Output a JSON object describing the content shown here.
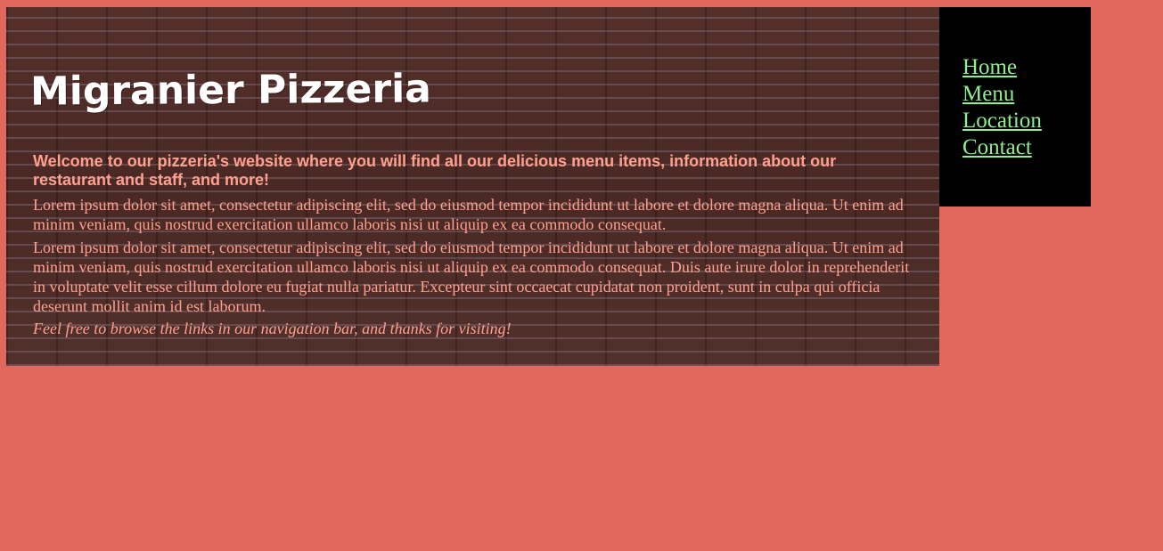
{
  "site": {
    "title": "Migranier Pizzeria",
    "welcome": "Welcome to our pizzeria's website where you will find all our delicious menu items, information about our restaurant and staff, and more!",
    "paragraphs": [
      "Lorem ipsum dolor sit amet, consectetur adipiscing elit, sed do eiusmod tempor incididunt ut labore et dolore magna aliqua. Ut enim ad minim veniam, quis nostrud exercitation ullamco laboris nisi ut aliquip ex ea commodo consequat.",
      "Lorem ipsum dolor sit amet, consectetur adipiscing elit, sed do eiusmod tempor incididunt ut labore et dolore magna aliqua. Ut enim ad minim veniam, quis nostrud exercitation ullamco laboris nisi ut aliquip ex ea commodo consequat. Duis aute irure dolor in reprehenderit in voluptate velit esse cillum dolore eu fugiat nulla pariatur. Excepteur sint occaecat cupidatat non proident, sunt in culpa qui officia deserunt mollit anim id est laborum."
    ],
    "closing": "Feel free to browse the links in our navigation bar, and thanks for visiting!"
  },
  "nav": {
    "items": [
      {
        "label": "Home"
      },
      {
        "label": "Menu"
      },
      {
        "label": "Location"
      },
      {
        "label": "Contact"
      }
    ]
  },
  "colors": {
    "page_background": "#e2685d",
    "text_accent": "#ffa08f",
    "nav_background": "#000000",
    "nav_link": "#90ee90",
    "title": "#ffffff"
  }
}
